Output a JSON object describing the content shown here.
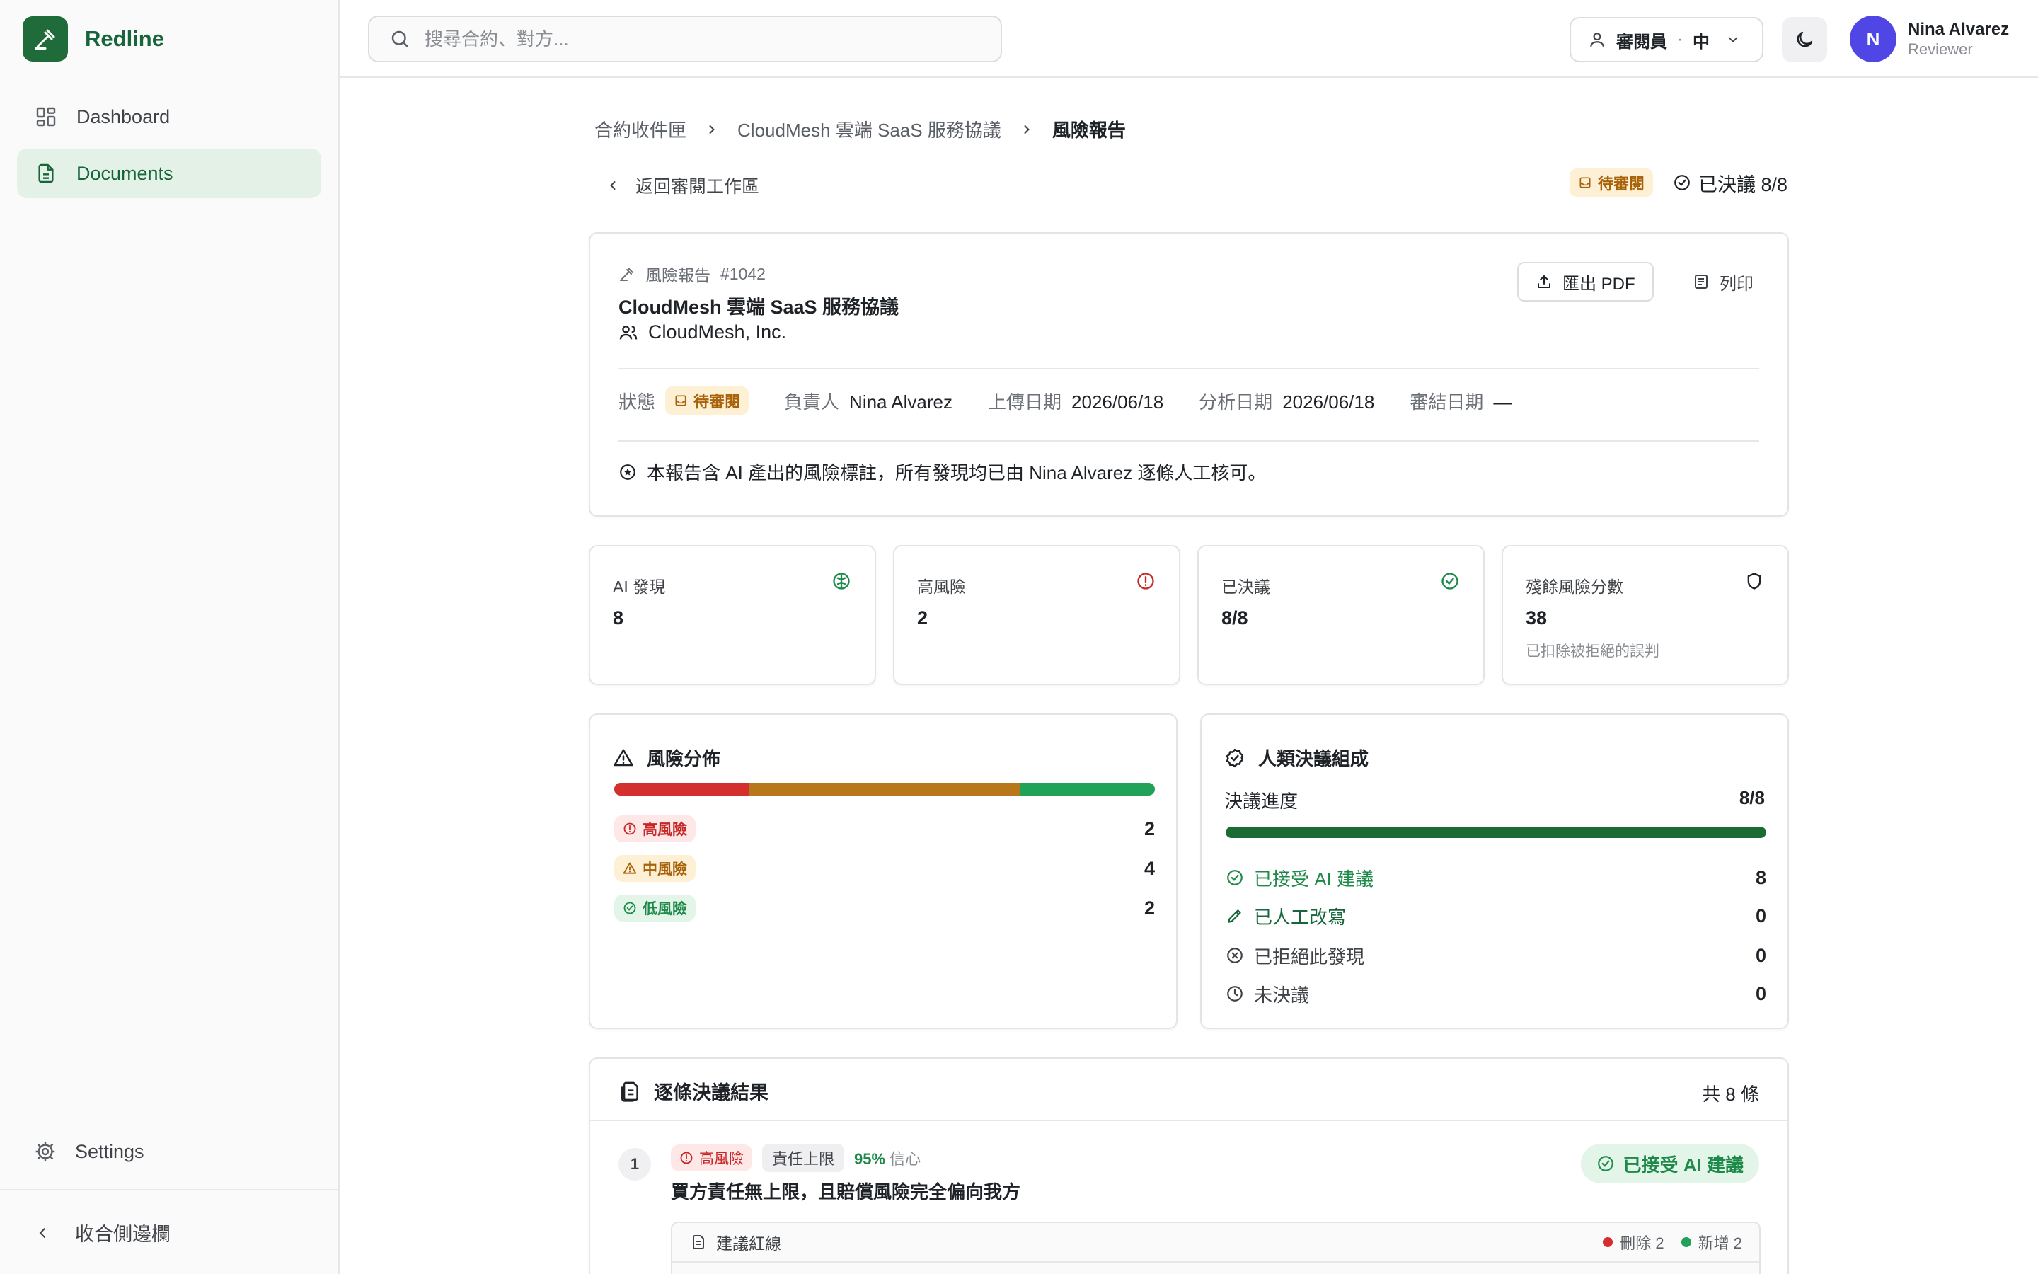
{
  "app": {
    "name": "Redline"
  },
  "sidebar": {
    "items": [
      {
        "label": "Dashboard",
        "icon": "grid-icon"
      },
      {
        "label": "Documents",
        "icon": "document-icon",
        "active": true
      }
    ],
    "settings_label": "Settings",
    "collapse_label": "收合側邊欄"
  },
  "topbar": {
    "search_placeholder": "搜尋合約、對方...",
    "role_label": "審閱員",
    "role_separator": "·",
    "language": "中",
    "user": {
      "initial": "N",
      "name": "Nina Alvarez",
      "role": "Reviewer"
    }
  },
  "breadcrumb": [
    "合約收件匣",
    "CloudMesh 雲端 SaaS 服務協議",
    "風險報告"
  ],
  "back_label": "返回審閱工作區",
  "status": {
    "pending_label": "待審閱",
    "resolved_label": "已決議 8/8"
  },
  "report": {
    "type_label": "風險報告",
    "number": "#1042",
    "title": "CloudMesh 雲端 SaaS 服務協議",
    "party": "CloudMesh, Inc.",
    "export_label": "匯出 PDF",
    "print_label": "列印",
    "meta": {
      "status_label": "狀態",
      "status_value": "待審閱",
      "owner_label": "負責人",
      "owner_value": "Nina Alvarez",
      "upload_label": "上傳日期",
      "upload_value": "2026/06/18",
      "analysis_label": "分析日期",
      "analysis_value": "2026/06/18",
      "close_label": "審結日期",
      "close_value": "—"
    },
    "note": "本報告含 AI 產出的風險標註，所有發現均已由 Nina Alvarez 逐條人工核可。"
  },
  "stats": [
    {
      "label": "AI 發現",
      "value": "8",
      "sub": "",
      "icon": "brain-icon",
      "color": "#1d8a4a"
    },
    {
      "label": "高風險",
      "value": "2",
      "sub": "",
      "icon": "alert-circle-icon",
      "color": "#c62828"
    },
    {
      "label": "已決議",
      "value": "8/8",
      "sub": "",
      "icon": "check-circle-icon",
      "color": "#1d8a4a"
    },
    {
      "label": "殘餘風險分數",
      "value": "38",
      "sub": "已扣除被拒絕的誤判",
      "icon": "shield-icon",
      "color": "#1f2328"
    }
  ],
  "risk_distribution": {
    "title": "風險分佈",
    "segments": [
      {
        "label": "高風險",
        "count": "2",
        "value": 2,
        "color": "#d32f2f"
      },
      {
        "label": "中風險",
        "count": "4",
        "value": 4,
        "color": "#b8771a"
      },
      {
        "label": "低風險",
        "count": "2",
        "value": 2,
        "color": "#22a158"
      }
    ]
  },
  "decisions": {
    "title": "人類決議組成",
    "progress_label": "決議進度",
    "progress_value": "8/8",
    "progress_fraction": 1.0,
    "rows": [
      {
        "label": "已接受 AI 建議",
        "count": "8",
        "color": "#1d8a4a",
        "icon": "check-circle-icon"
      },
      {
        "label": "已人工改寫",
        "count": "0",
        "color": "#17653a",
        "icon": "pencil-icon"
      },
      {
        "label": "已拒絕此發現",
        "count": "0",
        "color": "#3f4247",
        "icon": "x-circle-icon"
      },
      {
        "label": "未決議",
        "count": "0",
        "color": "#3f4247",
        "icon": "clock-icon"
      }
    ]
  },
  "results": {
    "title": "逐條決議結果",
    "total": "共 8 條",
    "items": [
      {
        "number": "1",
        "risk": "高風險",
        "category": "責任上限",
        "confidence": "95%",
        "confidence_label": "信心",
        "title": "買方責任無上限，且賠償風險完全偏向我方",
        "decision": "已接受 AI 建議",
        "redline": {
          "title": "建議紅線",
          "deleted_label": "刪除 2",
          "added_label": "新增 2"
        }
      }
    ]
  }
}
